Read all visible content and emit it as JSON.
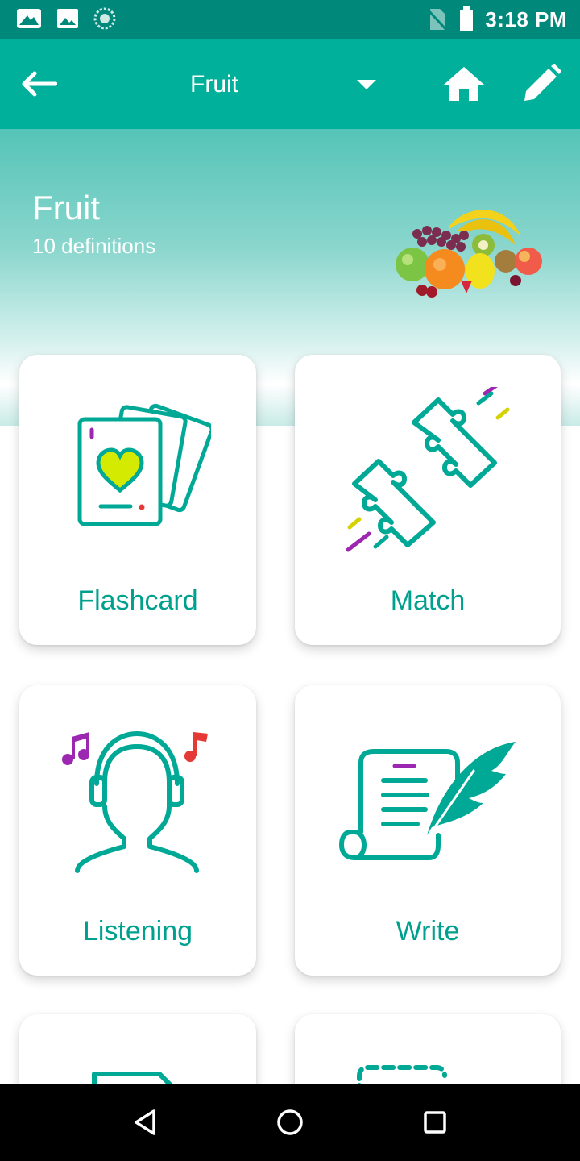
{
  "status_bar": {
    "time": "3:18 PM",
    "icons": [
      "photo-frame-icon",
      "image-icon",
      "sync-circle-icon",
      "no-sim-icon",
      "battery-icon"
    ]
  },
  "app_bar": {
    "title": "Fruit",
    "icons": [
      "back-arrow-icon",
      "dropdown-caret-icon",
      "home-icon",
      "pencil-icon"
    ]
  },
  "header": {
    "deck_title": "Fruit",
    "definitions_count": "10 definitions"
  },
  "modes": [
    {
      "label": "Flashcard",
      "icon": "flashcard-icon"
    },
    {
      "label": "Match",
      "icon": "puzzle-icon"
    },
    {
      "label": "Listening",
      "icon": "headphones-person-icon"
    },
    {
      "label": "Write",
      "icon": "quill-scroll-icon"
    }
  ],
  "nav_bar": {
    "icons": [
      "back-triangle-icon",
      "home-circle-icon",
      "recents-square-icon"
    ]
  },
  "colors": {
    "status_bar": "#00897b",
    "app_bar": "#00b09b",
    "accent_teal": "#00a896",
    "label_teal": "#00a08e",
    "purple": "#9c27b0",
    "yellow": "#d4d200",
    "red": "#e53935"
  }
}
